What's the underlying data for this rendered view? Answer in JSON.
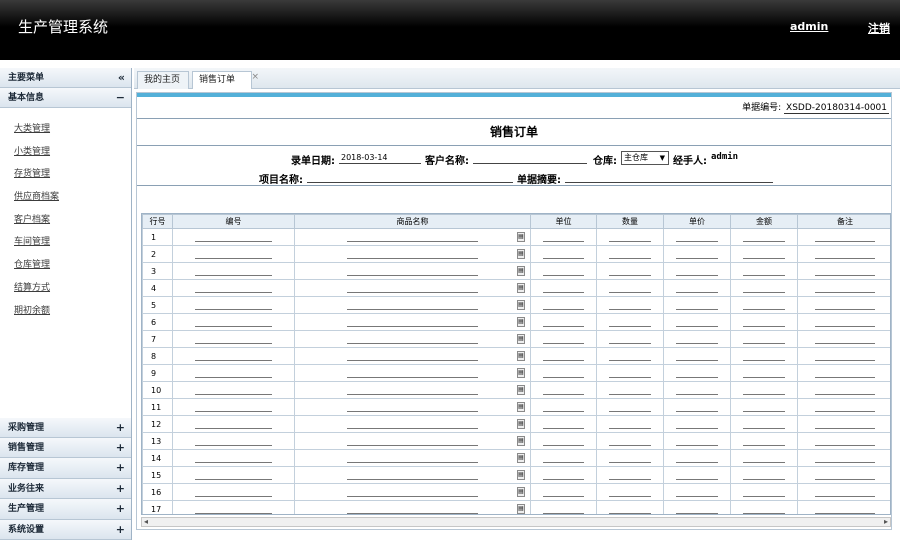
{
  "header": {
    "title": "生产管理系统",
    "user": "admin",
    "logout": "注销"
  },
  "sidebar": {
    "menu_title": "主要菜单",
    "collapse_icon": "«",
    "section_title": "基本信息",
    "section_ctl": "−",
    "items": [
      "大类管理",
      "小类管理",
      "存货管理",
      "供应商档案",
      "客户档案",
      "车间管理",
      "仓库管理",
      "结算方式",
      "期初余额"
    ],
    "groups": [
      "采购管理",
      "销售管理",
      "库存管理",
      "业务往来",
      "生产管理",
      "系统设置"
    ],
    "group_ctl": "+"
  },
  "tabs": {
    "home": "我的主页",
    "order": "销售订单",
    "close": "×"
  },
  "form": {
    "doc_no_label": "单据编号:",
    "doc_no": "XSDD-20180314-0001",
    "title": "销售订单",
    "date_label": "录单日期:",
    "date": "2018-03-14",
    "customer_label": "客户名称:",
    "warehouse_label": "仓库:",
    "warehouse": "主仓库",
    "handler_label": "经手人:",
    "handler": "admin",
    "project_label": "项目名称:",
    "summary_label": "单据摘要:"
  },
  "grid": {
    "columns": [
      "行号",
      "编号",
      "商品名称",
      "单位",
      "数量",
      "单价",
      "金额",
      "备注"
    ],
    "rows": [
      "1",
      "2",
      "3",
      "4",
      "5",
      "6",
      "7",
      "8",
      "9",
      "10",
      "11",
      "12",
      "13",
      "14",
      "15",
      "16",
      "17"
    ],
    "lookup_icon": "▤"
  }
}
